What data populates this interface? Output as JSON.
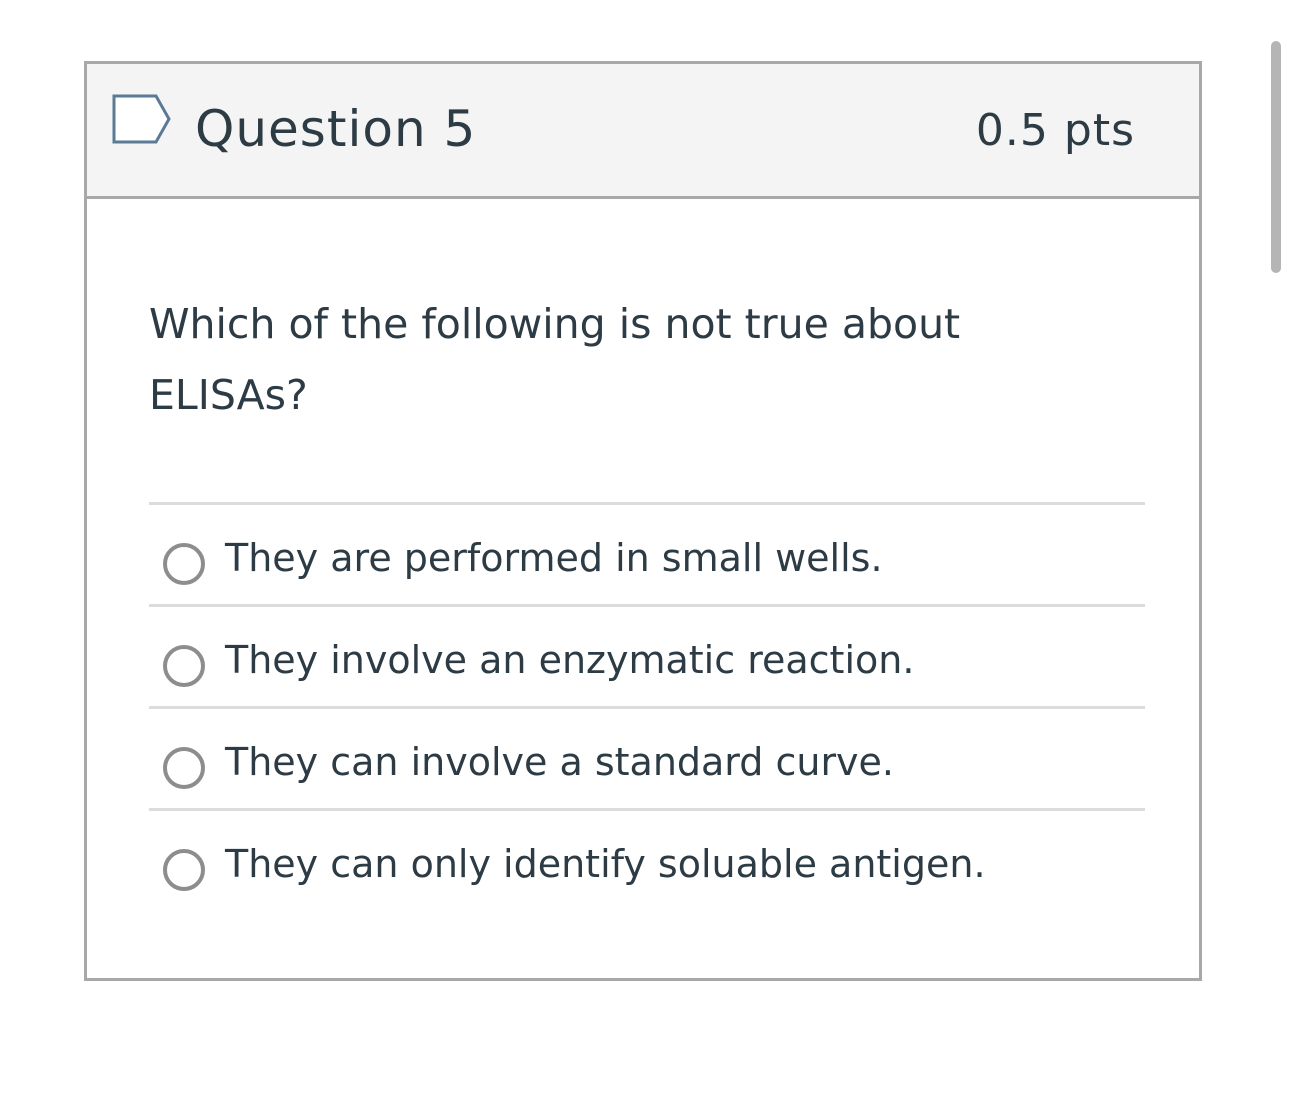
{
  "question": {
    "title": "Question 5",
    "points": "0.5 pts",
    "flag_icon": "flag-outline-icon",
    "text": "Which of the following is not true about ELISAs?",
    "answers": [
      {
        "label": "They are performed in small wells.",
        "selected": false
      },
      {
        "label": "They involve an enzymatic reaction.",
        "selected": false
      },
      {
        "label": "They can involve a standard curve.",
        "selected": false
      },
      {
        "label": "They can only identify soluable antigen.",
        "selected": false
      }
    ]
  },
  "colors": {
    "header_background": "#f4f4f4",
    "border": "#a8a8a8",
    "text": "#2d3b45",
    "flag_outline": "#5a7a96",
    "radio": "#8d8d8d"
  }
}
